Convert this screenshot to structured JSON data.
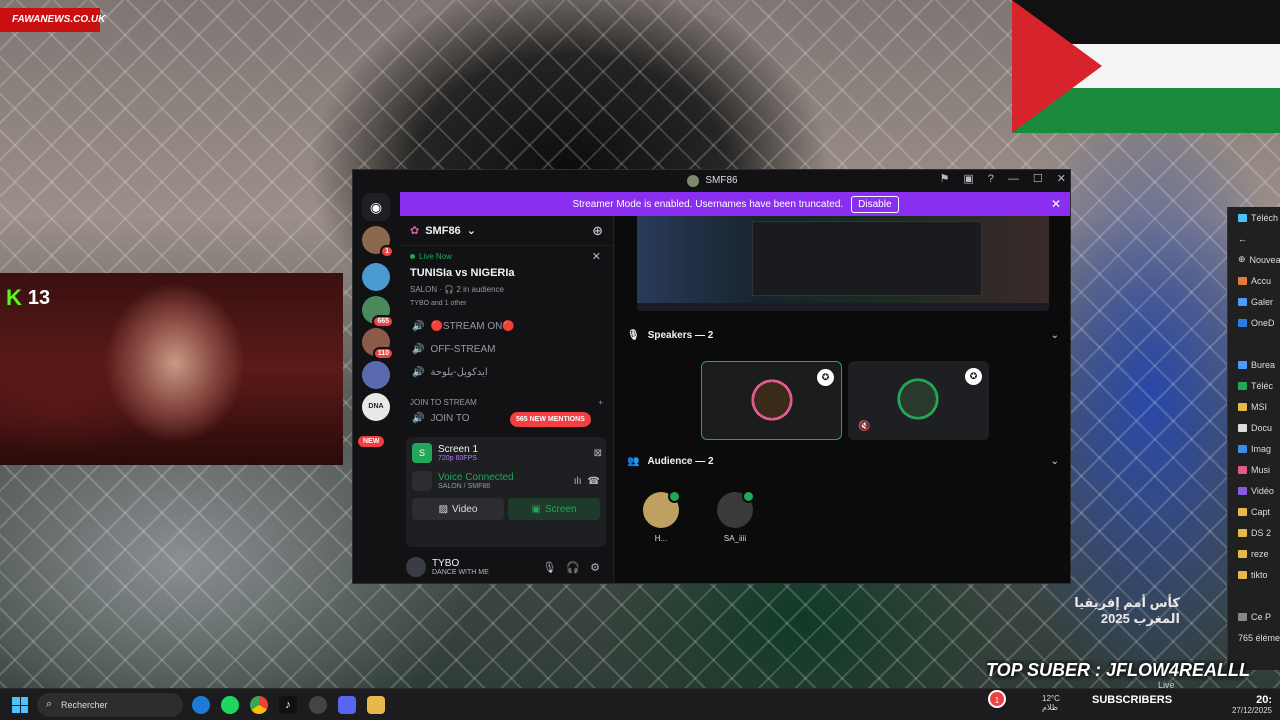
{
  "overlay": {
    "site_tag": "FAWANEWS.CO.UK",
    "kick_count": "13",
    "tournament_ar": "كأس أمم إفريقيا",
    "tournament_country_ar": "المغرب",
    "tournament_year": "2025",
    "top_suber": "TOP SUBER : JFLOW4REALLL",
    "subscribers": "SUBSCRIBERS",
    "subscriber_count": "1",
    "live": "Live"
  },
  "explorer": {
    "items": [
      "Téléch",
      "Nouvea",
      "Accu",
      "Galer",
      "OneD",
      "Burea",
      "Téléc",
      "MSI",
      "Docu",
      "Imag",
      "Musi",
      "Vidéo",
      "Capt",
      "DS 2",
      "reze",
      "tikto",
      "Ce P",
      "765 élément"
    ]
  },
  "window": {
    "title": "SMF86",
    "banner_text": "Streamer Mode is enabled. Usernames have been truncated.",
    "banner_button": "Disable"
  },
  "rail": {
    "badges": [
      "1",
      "665",
      "110"
    ],
    "new_label": "NEW",
    "dna_label": "DNA"
  },
  "channels": {
    "server_name": "SMF86",
    "live_now": "Live Now",
    "stage_title": "TUNISIa vs NIGERIa",
    "stage_meta": "SALON · 🎧 2 in audience",
    "stage_people": "TYBO and 1 other",
    "list": [
      {
        "name": "🔴STREAM ON🔴"
      },
      {
        "name": "OFF-STREAM"
      },
      {
        "name": "ايدكويل-بلوحة"
      }
    ],
    "category": "JOIN TO STREAM",
    "join_channel": "JOIN TO",
    "mentions": "565 NEW MENTIONS"
  },
  "screenshare": {
    "title": "Screen 1",
    "quality": "720p 60FPS"
  },
  "voice": {
    "status": "Voice Connected",
    "location": "SALON / SMF86",
    "video_label": "Video",
    "screen_label": "Screen"
  },
  "user": {
    "name": "TYBO",
    "status": "DANCE WITH ME"
  },
  "stage": {
    "speakers_header": "Speakers — 2",
    "audience_header": "Audience — 2",
    "audience": [
      {
        "name": "H..."
      },
      {
        "name": "SA_iiii"
      }
    ]
  },
  "taskbar": {
    "search_placeholder": "Rechercher",
    "temperature": "12°C",
    "temp_sub": "ظلام",
    "time": "20:",
    "date": "27/12/2025"
  },
  "colors": {
    "accent": "#8a2ff0",
    "online": "#23a55a",
    "danger": "#f23f43"
  }
}
